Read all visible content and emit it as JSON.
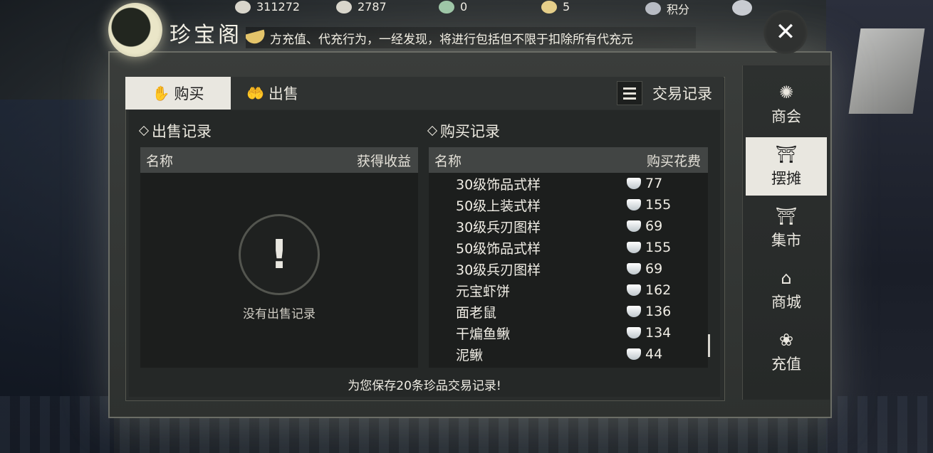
{
  "resources": [
    {
      "icon": "jade-currency-icon",
      "value": "311272"
    },
    {
      "icon": "silver-ingot-icon",
      "value": "2787"
    },
    {
      "icon": "green-ticket-icon",
      "value": "0"
    },
    {
      "icon": "gold-ingot-icon",
      "value": "5"
    },
    {
      "icon": "emblem-icon",
      "value": "积分"
    }
  ],
  "window": {
    "title": "珍宝阁",
    "marquee": "方充值、代充行为，一经发现，将进行包括但不限于扣除所有代充元",
    "close_glyph": "✕"
  },
  "tabs": {
    "buy": "购买",
    "sell": "出售",
    "transactions": "交易记录"
  },
  "sell_records": {
    "title": "出售记录",
    "columns": [
      "名称",
      "获得收益"
    ],
    "empty_message": "没有出售记录",
    "empty_glyph": "!"
  },
  "buy_records": {
    "title": "购买记录",
    "columns": [
      "名称",
      "购买花费"
    ],
    "rows": [
      {
        "name": "30级饰品式样",
        "cost": "77"
      },
      {
        "name": "50级上装式样",
        "cost": "155"
      },
      {
        "name": "30级兵刃图样",
        "cost": "69"
      },
      {
        "name": "50级饰品式样",
        "cost": "155"
      },
      {
        "name": "30级兵刃图样",
        "cost": "69"
      },
      {
        "name": "元宝虾饼",
        "cost": "162"
      },
      {
        "name": "面老鼠",
        "cost": "136"
      },
      {
        "name": "干煸鱼鳅",
        "cost": "134"
      },
      {
        "name": "泥鳅",
        "cost": "44"
      }
    ]
  },
  "footer": "为您保存20条珍品交易记录!",
  "sidebar": {
    "items": [
      {
        "label": "商会",
        "icon": "guild-emblem-icon",
        "active": false
      },
      {
        "label": "摆摊",
        "icon": "stall-icon",
        "active": true
      },
      {
        "label": "集市",
        "icon": "market-icon",
        "active": false
      },
      {
        "label": "商城",
        "icon": "mall-pavilion-icon",
        "active": false
      },
      {
        "label": "充值",
        "icon": "money-bag-icon",
        "active": false
      }
    ]
  }
}
